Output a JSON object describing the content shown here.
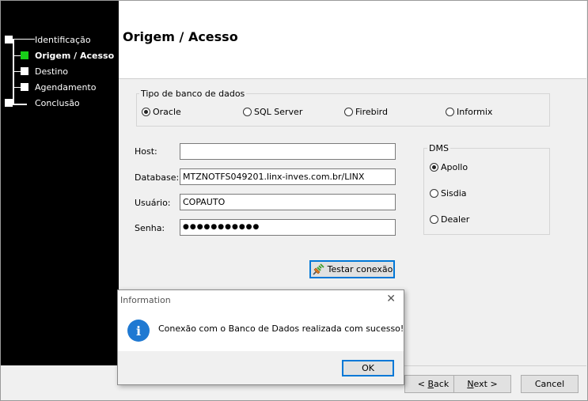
{
  "wizard": {
    "steps": [
      {
        "label": "Identificação",
        "active": false
      },
      {
        "label": "Origem / Acesso",
        "active": true
      },
      {
        "label": "Destino",
        "active": false
      },
      {
        "label": "Agendamento",
        "active": false
      },
      {
        "label": "Conclusão",
        "active": false
      }
    ],
    "page_title": "Origem / Acesso"
  },
  "db_type": {
    "legend": "Tipo de banco de dados",
    "options": [
      "Oracle",
      "SQL Server",
      "Firebird",
      "Informix"
    ],
    "selected": "Oracle"
  },
  "connection": {
    "host_label": "Host:",
    "host_value": "",
    "database_label": "Database:",
    "database_value": "MTZNOTFS049201.linx-inves.com.br/LINX",
    "user_label": "Usuário:",
    "user_value": "COPAUTO",
    "password_label": "Senha:",
    "password_value": "●●●●●●●●●●●"
  },
  "dms": {
    "legend": "DMS",
    "options": [
      "Apollo",
      "Sisdia",
      "Dealer"
    ],
    "selected": "Apollo"
  },
  "test_button": {
    "label": "Testar conexão",
    "icon": "plug-icon"
  },
  "nav": {
    "back_prefix": "< ",
    "back_accel": "B",
    "back_rest": "ack",
    "next_accel": "N",
    "next_rest": "ext >",
    "cancel": "Cancel"
  },
  "dialog": {
    "title": "Information",
    "close": "✕",
    "icon": "i",
    "message": "Conexão com o Banco de Dados realizada com sucesso!",
    "ok": "OK"
  },
  "colors": {
    "active_step": "#18d018",
    "info_icon": "#1f79d2",
    "focus": "#0078d7"
  }
}
